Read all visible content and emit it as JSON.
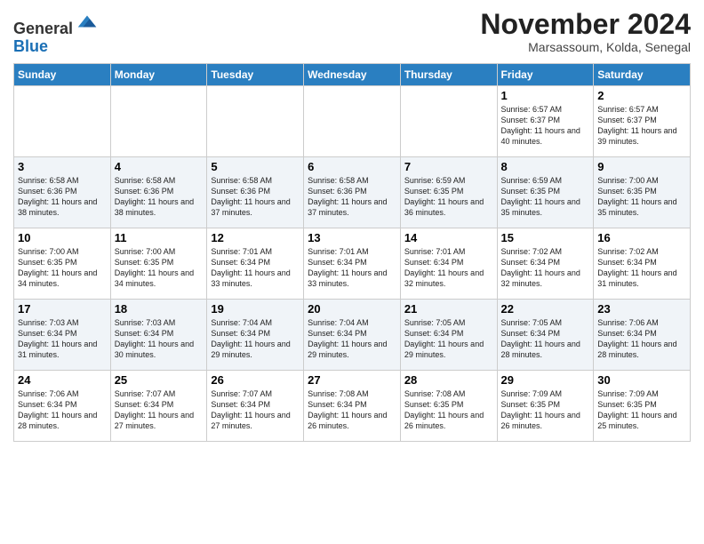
{
  "header": {
    "logo_line1": "General",
    "logo_line2": "Blue",
    "month": "November 2024",
    "location": "Marsassoum, Kolda, Senegal"
  },
  "weekdays": [
    "Sunday",
    "Monday",
    "Tuesday",
    "Wednesday",
    "Thursday",
    "Friday",
    "Saturday"
  ],
  "weeks": [
    [
      {
        "day": null
      },
      {
        "day": null
      },
      {
        "day": null
      },
      {
        "day": null
      },
      {
        "day": null
      },
      {
        "day": "1",
        "sunrise": "6:57 AM",
        "sunset": "6:37 PM",
        "daylight": "11 hours and 40 minutes."
      },
      {
        "day": "2",
        "sunrise": "6:57 AM",
        "sunset": "6:37 PM",
        "daylight": "11 hours and 39 minutes."
      }
    ],
    [
      {
        "day": "3",
        "sunrise": "6:58 AM",
        "sunset": "6:36 PM",
        "daylight": "11 hours and 38 minutes."
      },
      {
        "day": "4",
        "sunrise": "6:58 AM",
        "sunset": "6:36 PM",
        "daylight": "11 hours and 38 minutes."
      },
      {
        "day": "5",
        "sunrise": "6:58 AM",
        "sunset": "6:36 PM",
        "daylight": "11 hours and 37 minutes."
      },
      {
        "day": "6",
        "sunrise": "6:58 AM",
        "sunset": "6:36 PM",
        "daylight": "11 hours and 37 minutes."
      },
      {
        "day": "7",
        "sunrise": "6:59 AM",
        "sunset": "6:35 PM",
        "daylight": "11 hours and 36 minutes."
      },
      {
        "day": "8",
        "sunrise": "6:59 AM",
        "sunset": "6:35 PM",
        "daylight": "11 hours and 35 minutes."
      },
      {
        "day": "9",
        "sunrise": "7:00 AM",
        "sunset": "6:35 PM",
        "daylight": "11 hours and 35 minutes."
      }
    ],
    [
      {
        "day": "10",
        "sunrise": "7:00 AM",
        "sunset": "6:35 PM",
        "daylight": "11 hours and 34 minutes."
      },
      {
        "day": "11",
        "sunrise": "7:00 AM",
        "sunset": "6:35 PM",
        "daylight": "11 hours and 34 minutes."
      },
      {
        "day": "12",
        "sunrise": "7:01 AM",
        "sunset": "6:34 PM",
        "daylight": "11 hours and 33 minutes."
      },
      {
        "day": "13",
        "sunrise": "7:01 AM",
        "sunset": "6:34 PM",
        "daylight": "11 hours and 33 minutes."
      },
      {
        "day": "14",
        "sunrise": "7:01 AM",
        "sunset": "6:34 PM",
        "daylight": "11 hours and 32 minutes."
      },
      {
        "day": "15",
        "sunrise": "7:02 AM",
        "sunset": "6:34 PM",
        "daylight": "11 hours and 32 minutes."
      },
      {
        "day": "16",
        "sunrise": "7:02 AM",
        "sunset": "6:34 PM",
        "daylight": "11 hours and 31 minutes."
      }
    ],
    [
      {
        "day": "17",
        "sunrise": "7:03 AM",
        "sunset": "6:34 PM",
        "daylight": "11 hours and 31 minutes."
      },
      {
        "day": "18",
        "sunrise": "7:03 AM",
        "sunset": "6:34 PM",
        "daylight": "11 hours and 30 minutes."
      },
      {
        "day": "19",
        "sunrise": "7:04 AM",
        "sunset": "6:34 PM",
        "daylight": "11 hours and 29 minutes."
      },
      {
        "day": "20",
        "sunrise": "7:04 AM",
        "sunset": "6:34 PM",
        "daylight": "11 hours and 29 minutes."
      },
      {
        "day": "21",
        "sunrise": "7:05 AM",
        "sunset": "6:34 PM",
        "daylight": "11 hours and 29 minutes."
      },
      {
        "day": "22",
        "sunrise": "7:05 AM",
        "sunset": "6:34 PM",
        "daylight": "11 hours and 28 minutes."
      },
      {
        "day": "23",
        "sunrise": "7:06 AM",
        "sunset": "6:34 PM",
        "daylight": "11 hours and 28 minutes."
      }
    ],
    [
      {
        "day": "24",
        "sunrise": "7:06 AM",
        "sunset": "6:34 PM",
        "daylight": "11 hours and 28 minutes."
      },
      {
        "day": "25",
        "sunrise": "7:07 AM",
        "sunset": "6:34 PM",
        "daylight": "11 hours and 27 minutes."
      },
      {
        "day": "26",
        "sunrise": "7:07 AM",
        "sunset": "6:34 PM",
        "daylight": "11 hours and 27 minutes."
      },
      {
        "day": "27",
        "sunrise": "7:08 AM",
        "sunset": "6:34 PM",
        "daylight": "11 hours and 26 minutes."
      },
      {
        "day": "28",
        "sunrise": "7:08 AM",
        "sunset": "6:35 PM",
        "daylight": "11 hours and 26 minutes."
      },
      {
        "day": "29",
        "sunrise": "7:09 AM",
        "sunset": "6:35 PM",
        "daylight": "11 hours and 26 minutes."
      },
      {
        "day": "30",
        "sunrise": "7:09 AM",
        "sunset": "6:35 PM",
        "daylight": "11 hours and 25 minutes."
      }
    ]
  ]
}
